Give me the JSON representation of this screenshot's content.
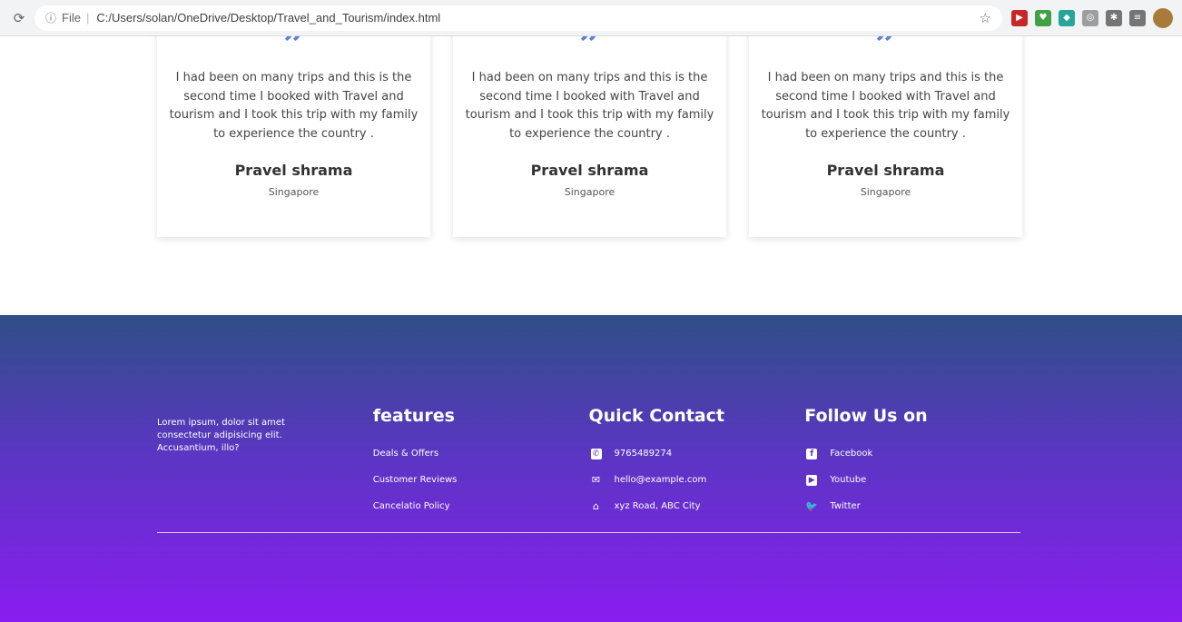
{
  "browser": {
    "file_label": "File",
    "url": "C:/Users/solan/OneDrive/Desktop/Travel_and_Tourism/index.html"
  },
  "testimonials": [
    {
      "text": "I had been on many trips and this is the second time I booked with Travel and tourism and I took this trip with my family to experience the country .",
      "name": "Pravel shrama",
      "location": "Singapore"
    },
    {
      "text": "I had been on many trips and this is the second time I booked with Travel and tourism and I took this trip with my family to experience the country .",
      "name": "Pravel shrama",
      "location": "Singapore"
    },
    {
      "text": "I had been on many trips and this is the second time I booked with Travel and tourism and I took this trip with my family to experience the country .",
      "name": "Pravel shrama",
      "location": "Singapore"
    }
  ],
  "footer": {
    "about": "Lorem ipsum, dolor sit amet consectetur adipisicing elit. Accusantium, illo?",
    "features": {
      "title": "features",
      "items": [
        "Deals & Offers",
        "Customer Reviews",
        "Cancelatio Policy"
      ]
    },
    "contact": {
      "title": "Quick Contact",
      "phone": "9765489274",
      "email": "hello@example.com",
      "address": "xyz Road, ABC City"
    },
    "follow": {
      "title": "Follow Us on",
      "items": [
        "Facebook",
        "Youtube",
        "Twitter"
      ]
    }
  },
  "colors": {
    "footer_top": "#2f4f86",
    "footer_bottom": "#8a1df0",
    "quote": "#5b7fdb"
  }
}
